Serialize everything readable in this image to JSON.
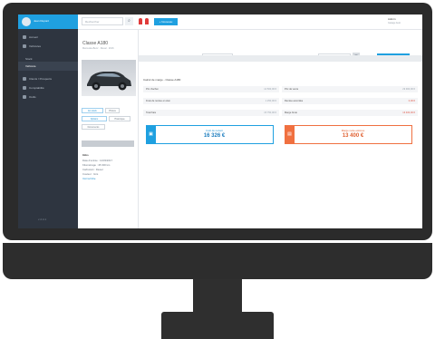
{
  "sidebar": {
    "user_name": "Jean Dupont",
    "items": [
      {
        "label": "Accueil",
        "type": "main"
      },
      {
        "label": "Véhicules",
        "type": "main"
      },
      {
        "label": "Stock",
        "type": "sub"
      },
      {
        "label": "Véhicule",
        "type": "sub-active"
      },
      {
        "label": "Clients / Prospects",
        "type": "main"
      },
      {
        "label": "Comptabilité",
        "type": "main"
      },
      {
        "label": "Outils",
        "type": "main"
      }
    ],
    "footer": "v 2.4.1"
  },
  "topbar": {
    "search_placeholder": "Rechercher",
    "search_icon": "search-icon",
    "new_button": "+ Nouveau",
    "user_name": "Admin",
    "user_sub": "Garage Auto"
  },
  "detail": {
    "car_title": "Classe A180",
    "car_subtitle": "Mercedes-Benz · Diesel · 2016",
    "chips": [
      "En stock",
      "Photos",
      "Options",
      "Historique",
      "Documents"
    ],
    "info_title": "Infos",
    "info_lines": [
      "Date d'entrée : 12/03/2017",
      "Kilométrage : 45 000 km",
      "Carburant : Diesel",
      "Couleur : Gris",
      "Voir la fiche"
    ]
  },
  "filter": {
    "label_left": "Période du",
    "input_left": "01/01/2017",
    "label_right": "jusqu'au",
    "input_right": "31/12/2017",
    "apply_button": "Calculer la marge"
  },
  "result": {
    "section_title": "Calcul de marge - Classe A180",
    "rows_left": [
      {
        "label": "Prix d'achat",
        "value": "14 500,00 €"
      },
      {
        "label": "Frais de remise en état",
        "value": "1 250,00 €"
      },
      {
        "label": "Total frais",
        "value": "15 750,00 €"
      }
    ],
    "rows_right": [
      {
        "label": "Prix de vente",
        "value": "29 900,00 €",
        "red": false
      },
      {
        "label": "Remise accordée",
        "value": "0,00 €",
        "red": true
      },
      {
        "label": "Marge brute",
        "value": "13 400,00 €",
        "red": true
      }
    ],
    "cost_box": {
      "caption": "Coût de revient",
      "amount": "16 326 €",
      "icon": "cart-icon"
    },
    "margin_box": {
      "caption": "Marge nette estimée",
      "amount": "13 400 €",
      "icon": "chart-icon"
    }
  }
}
